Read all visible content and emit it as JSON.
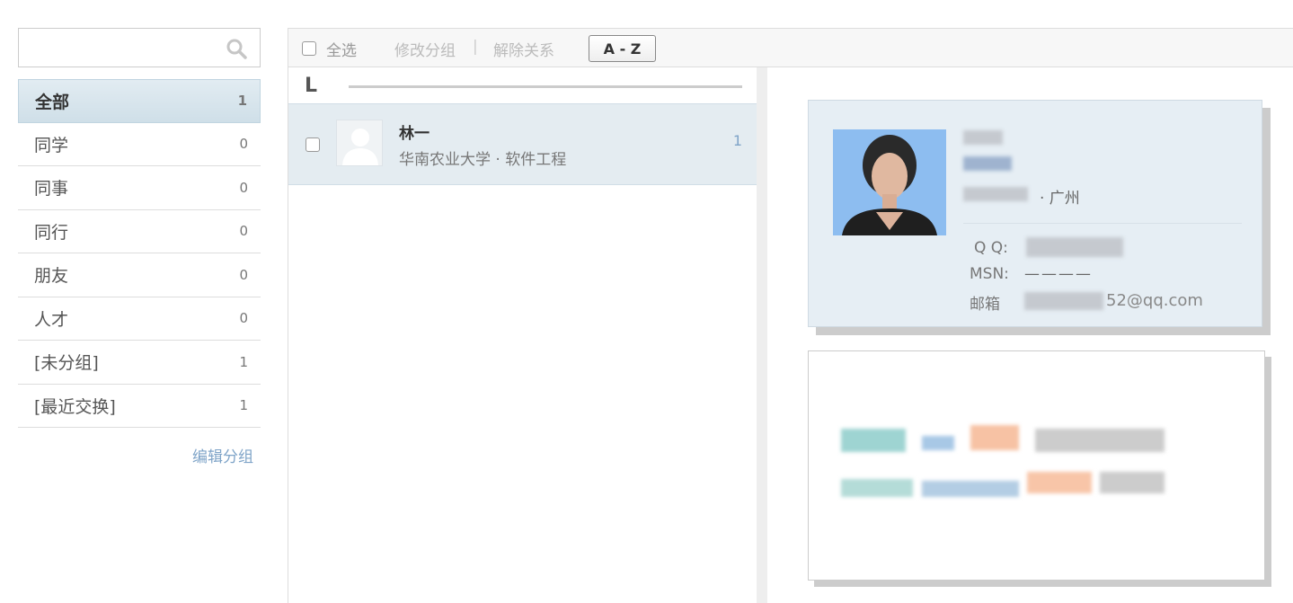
{
  "search": {
    "value": "",
    "placeholder": "",
    "icon": "search-icon"
  },
  "groups": [
    {
      "label": "全部",
      "count": "1",
      "active": true
    },
    {
      "label": "同学",
      "count": "0"
    },
    {
      "label": "同事",
      "count": "0"
    },
    {
      "label": "同行",
      "count": "0"
    },
    {
      "label": "朋友",
      "count": "0"
    },
    {
      "label": "人才",
      "count": "0"
    },
    {
      "label": "[未分组]",
      "count": "1"
    },
    {
      "label": "[最近交换]",
      "count": "1"
    }
  ],
  "edit_groups_label": "编辑分组",
  "toolbar": {
    "select_all": "全选",
    "modify_group": "修改分组",
    "separator": "|",
    "remove_relation": "解除关系",
    "sort_label": "A - Z"
  },
  "list": {
    "letter": "L",
    "contact": {
      "name": "林一",
      "info": "华南农业大学 · 软件工程",
      "count": "1"
    }
  },
  "card": {
    "city": "· 广州",
    "qq_label": "Q Q:",
    "msn_label": "MSN:",
    "msn_value": "————",
    "email_label": "邮箱",
    "email_visible": "52@qq.com"
  },
  "colors": {
    "accent": "#7fa4c8",
    "active_group_bg": "#d6e4ec",
    "card_bg": "#e6eef4"
  }
}
